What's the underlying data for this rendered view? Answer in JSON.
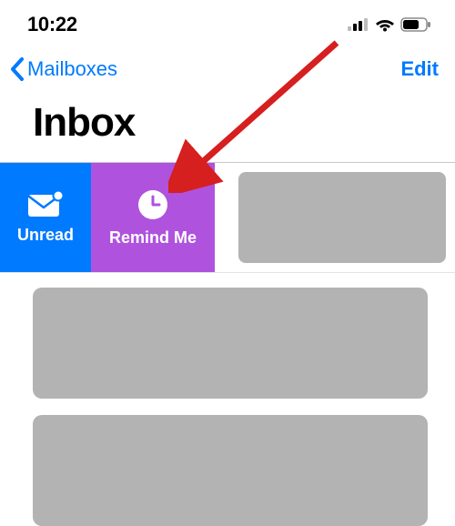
{
  "status_bar": {
    "time": "10:22"
  },
  "nav": {
    "back_label": "Mailboxes",
    "edit_label": "Edit"
  },
  "title": "Inbox",
  "swipe_actions": {
    "unread_label": "Unread",
    "remind_label": "Remind Me"
  },
  "colors": {
    "accent": "#007aff",
    "remind": "#af52de",
    "arrow": "#d61f1f"
  }
}
